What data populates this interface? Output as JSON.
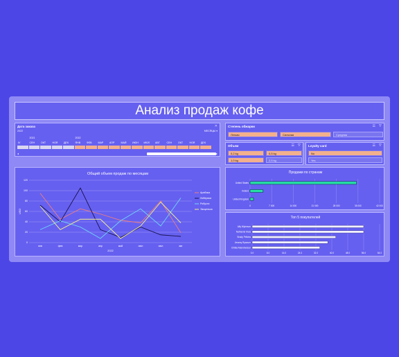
{
  "dashboard": {
    "title": "Анализ продаж кофе"
  },
  "date_slicer": {
    "title": "Дата заказа",
    "year_label": "2022",
    "level_label": "МЕСЯЦЫ",
    "timeline_years": [
      "2021",
      "2022"
    ],
    "months": [
      "IV",
      "СЕН",
      "ОКТ",
      "НОЯ",
      "ДЕК",
      "ЯНВ",
      "ФЕВ",
      "МАР",
      "АПР",
      "МАЙ",
      "ИЮН",
      "ИЮЛ",
      "АВГ",
      "СЕН",
      "ОКТ",
      "НОЯ",
      "ДЕК"
    ]
  },
  "roast_slicer": {
    "title": "Степень обжарки",
    "items": [
      "Легкая",
      "Сильная",
      "Средняя"
    ]
  },
  "size_slicer": {
    "title": "Объем",
    "items": [
      "0,2 kg",
      "0,5 kg",
      "1,0 kg",
      "2,5 kg"
    ]
  },
  "loyalty_slicer": {
    "title": "Loyalty card",
    "items": [
      "No",
      "Yes"
    ]
  },
  "colors": {
    "selected": "#f3b08c",
    "panel": "#6660f0",
    "frame": "#8f89f5",
    "background": "#4c46e6",
    "bar_fill": "#27e0a6"
  },
  "chart_data": [
    {
      "type": "line",
      "title": "Общий объем продаж по месяцам",
      "ylabel": "USD",
      "xlabel": "2022",
      "categories": [
        "янв",
        "фев",
        "мар",
        "апр",
        "май",
        "июн",
        "июл",
        "авг"
      ],
      "ylim": [
        0,
        120
      ],
      "yticks": [
        "0",
        "20",
        "40",
        "60",
        "80",
        "100",
        "120"
      ],
      "series": [
        {
          "name": "Арабика",
          "color": "#f07d7d",
          "values": [
            95,
            45,
            65,
            55,
            43,
            38,
            80,
            19
          ]
        },
        {
          "name": "Либерика",
          "color": "#17124f",
          "values": [
            72,
            40,
            105,
            25,
            10,
            30,
            15,
            12
          ]
        },
        {
          "name": "Робуста",
          "color": "#6fd9f5",
          "values": [
            25,
            42,
            30,
            8,
            42,
            65,
            32,
            86
          ]
        },
        {
          "name": "Эксцельса",
          "color": "#f5f28a",
          "values": [
            70,
            25,
            45,
            45,
            8,
            32,
            78,
            38
          ]
        }
      ]
    },
    {
      "type": "bar",
      "title": "Продажи по странам",
      "categories": [
        "United States",
        "Ireland",
        "United Kingdom"
      ],
      "values": [
        34500,
        4200,
        1100
      ],
      "xlim": [
        0,
        42000
      ],
      "xticks": [
        "0",
        "7 000",
        "14 000",
        "21 000",
        "28 000",
        "35 000",
        "42 000"
      ]
    },
    {
      "type": "bar",
      "title": "Топ 5 покупателей",
      "categories": [
        "Alfy Wykeson",
        "Nathaniel Kleis",
        "Brady Pelkins",
        "Jeramy Ryseuer",
        "Childa Manninelson"
      ],
      "values": [
        56,
        56,
        42,
        38,
        34
      ],
      "xlim": [
        0,
        64
      ],
      "xticks": [
        "0.0",
        "8.0",
        "16.0",
        "24.0",
        "32.0",
        "40.0",
        "48.0",
        "56.0",
        "64.0"
      ]
    }
  ]
}
